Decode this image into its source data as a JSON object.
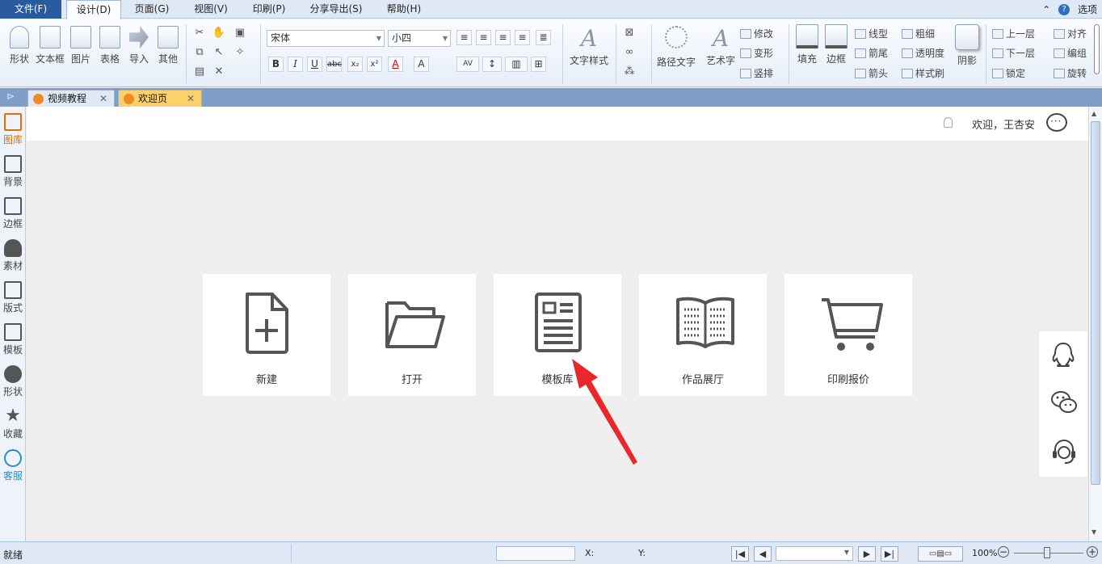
{
  "menubar": {
    "items": [
      "文件(F)",
      "设计(D)",
      "页面(G)",
      "视图(V)",
      "印刷(P)",
      "分享导出(S)",
      "帮助(H)"
    ],
    "options": "选项",
    "help_icon": "question-icon"
  },
  "ribbon": {
    "insert": [
      "形状",
      "文本框",
      "图片",
      "表格",
      "导入",
      "其他"
    ],
    "font_name": "宋体",
    "font_size": "小四",
    "text_style": "文字样式",
    "path_text": "路径文字",
    "art_text": "艺术字",
    "art_ops": [
      "修改",
      "变形",
      "竖排"
    ],
    "fill": "填充",
    "border": "边框",
    "line_ops": [
      "线型",
      "箭尾",
      "箭头"
    ],
    "fmt_ops": [
      "粗细",
      "透明度",
      "样式刷"
    ],
    "shadow": "阴影",
    "arrange": [
      "上一层",
      "下一层",
      "锁定"
    ],
    "arrange2": [
      "对齐",
      "编组",
      "旋转"
    ]
  },
  "tabs": [
    {
      "label": "视频教程"
    },
    {
      "label": "欢迎页"
    }
  ],
  "leftpanel": [
    "图库",
    "背景",
    "边框",
    "素材",
    "版式",
    "模板",
    "形状",
    "收藏",
    "客服"
  ],
  "header": {
    "welcome": "欢迎，王杏安"
  },
  "cards": [
    {
      "label": "新建",
      "icon": "new-file-icon"
    },
    {
      "label": "打开",
      "icon": "folder-open-icon"
    },
    {
      "label": "模板库",
      "icon": "template-document-icon"
    },
    {
      "label": "作品展厅",
      "icon": "open-book-icon"
    },
    {
      "label": "印刷报价",
      "icon": "shopping-cart-icon"
    }
  ],
  "float": [
    "qq-icon",
    "wechat-icon",
    "customer-service-headset-icon"
  ],
  "status": {
    "ready": "就绪",
    "x_label": "X:",
    "y_label": "Y:",
    "zoom": "100%"
  },
  "colors": {
    "accent": "#f08a24",
    "arrow": "#e8282b",
    "menu_file": "#2a5a9e"
  }
}
